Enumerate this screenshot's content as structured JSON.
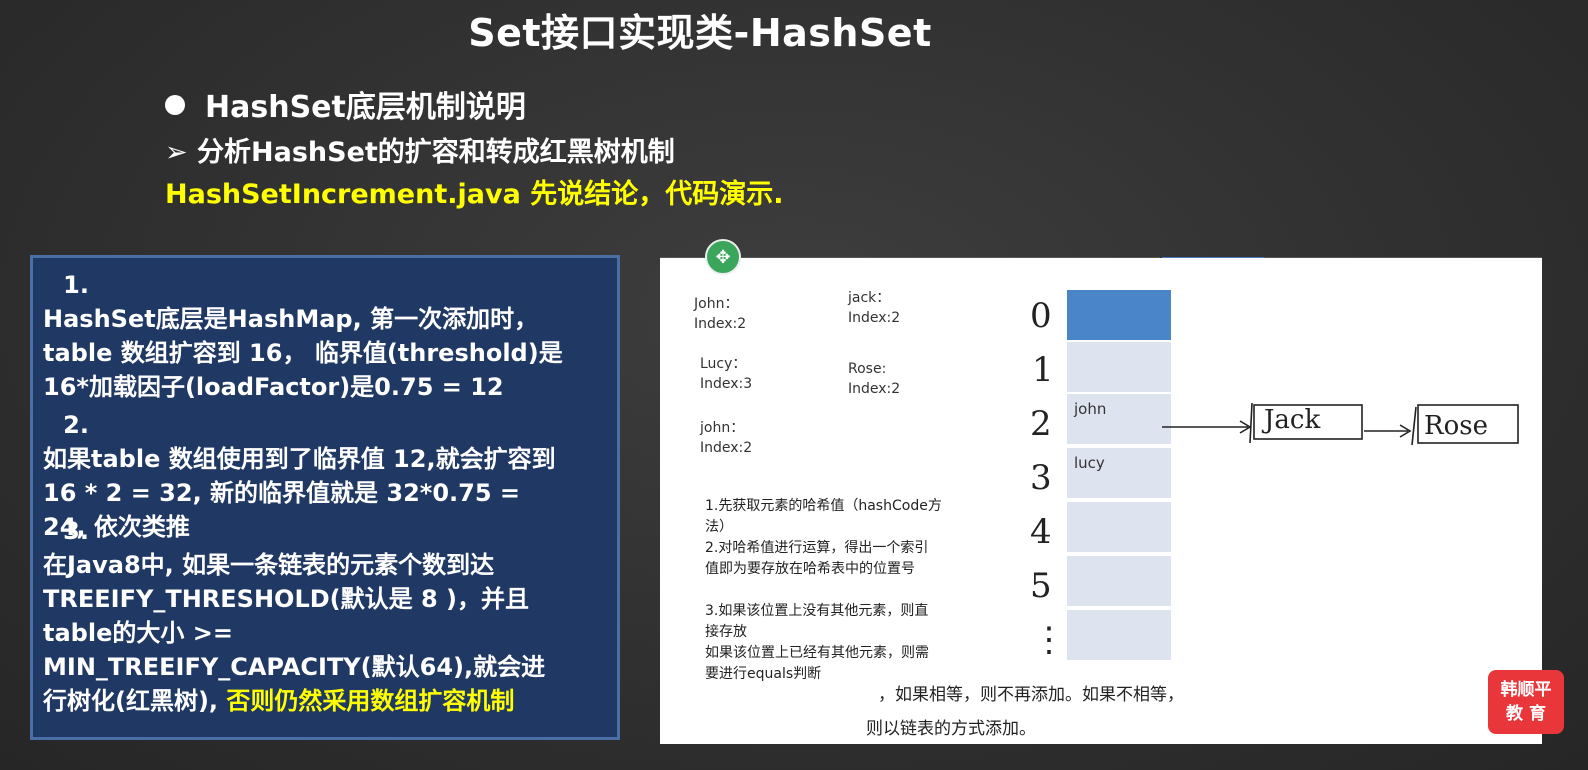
{
  "header": {
    "title": "Set接口实现类-HashSet",
    "bullet": "HashSet底层机制说明",
    "sub": "➢ 分析HashSet的扩容和转成红黑树机制",
    "yellow": "HashSetIncrement.java  先说结论，代码演示."
  },
  "points": [
    {
      "num": "1.",
      "text": "HashSet底层是HashMap, 第一次添加时，table 数组扩容到 16， 临界值(threshold)是 16*加载因子(loadFactor)是0.75 = 12"
    },
    {
      "num": "2.",
      "text": "如果table 数组使用到了临界值 12,就会扩容到 16 * 2 = 32, 新的临界值就是 32*0.75 = 24, 依次类推"
    },
    {
      "num": "3.",
      "text": "在Java8中, 如果一条链表的元素个数到达 TREEIFY_THRESHOLD(默认是 8 )，并且table的大小 >= MIN_TREEIFY_CAPACITY(默认64),就会进行树化(红黑树), ",
      "highlight": "否则仍然采用数组扩容机制"
    }
  ],
  "diagram": {
    "labels": {
      "john1": "John：",
      "john1_idx": "Index:2",
      "jack": "jack：",
      "jack_idx": "Index:2",
      "lucy": "Lucy：",
      "lucy_idx": "Index:3",
      "rose": "Rose:",
      "rose_idx": "Index:2",
      "john2": "john：",
      "john2_idx": "Index:2"
    },
    "indices": [
      "0",
      "1",
      "2",
      "3",
      "4",
      "5",
      "⋮"
    ],
    "cell_john": "john",
    "cell_lucy": "lucy",
    "node1": "Jack",
    "node2": "Rose",
    "steps": [
      "1.先获取元素的哈希值（hashCode方",
      "法）",
      "2.对哈希值进行运算，得出一个索引",
      "值即为要存放在哈希表中的位置号",
      "",
      "3.如果该位置上没有其他元素，则直",
      "接存放",
      "如果该位置上已经有其他元素，则需",
      "要进行equals判断"
    ],
    "note1": "，如果相等，则不再添加。如果不相等，",
    "note2": "则以链表的方式添加。"
  },
  "logo": {
    "line1": "韩顺平",
    "line2": "教  育"
  }
}
